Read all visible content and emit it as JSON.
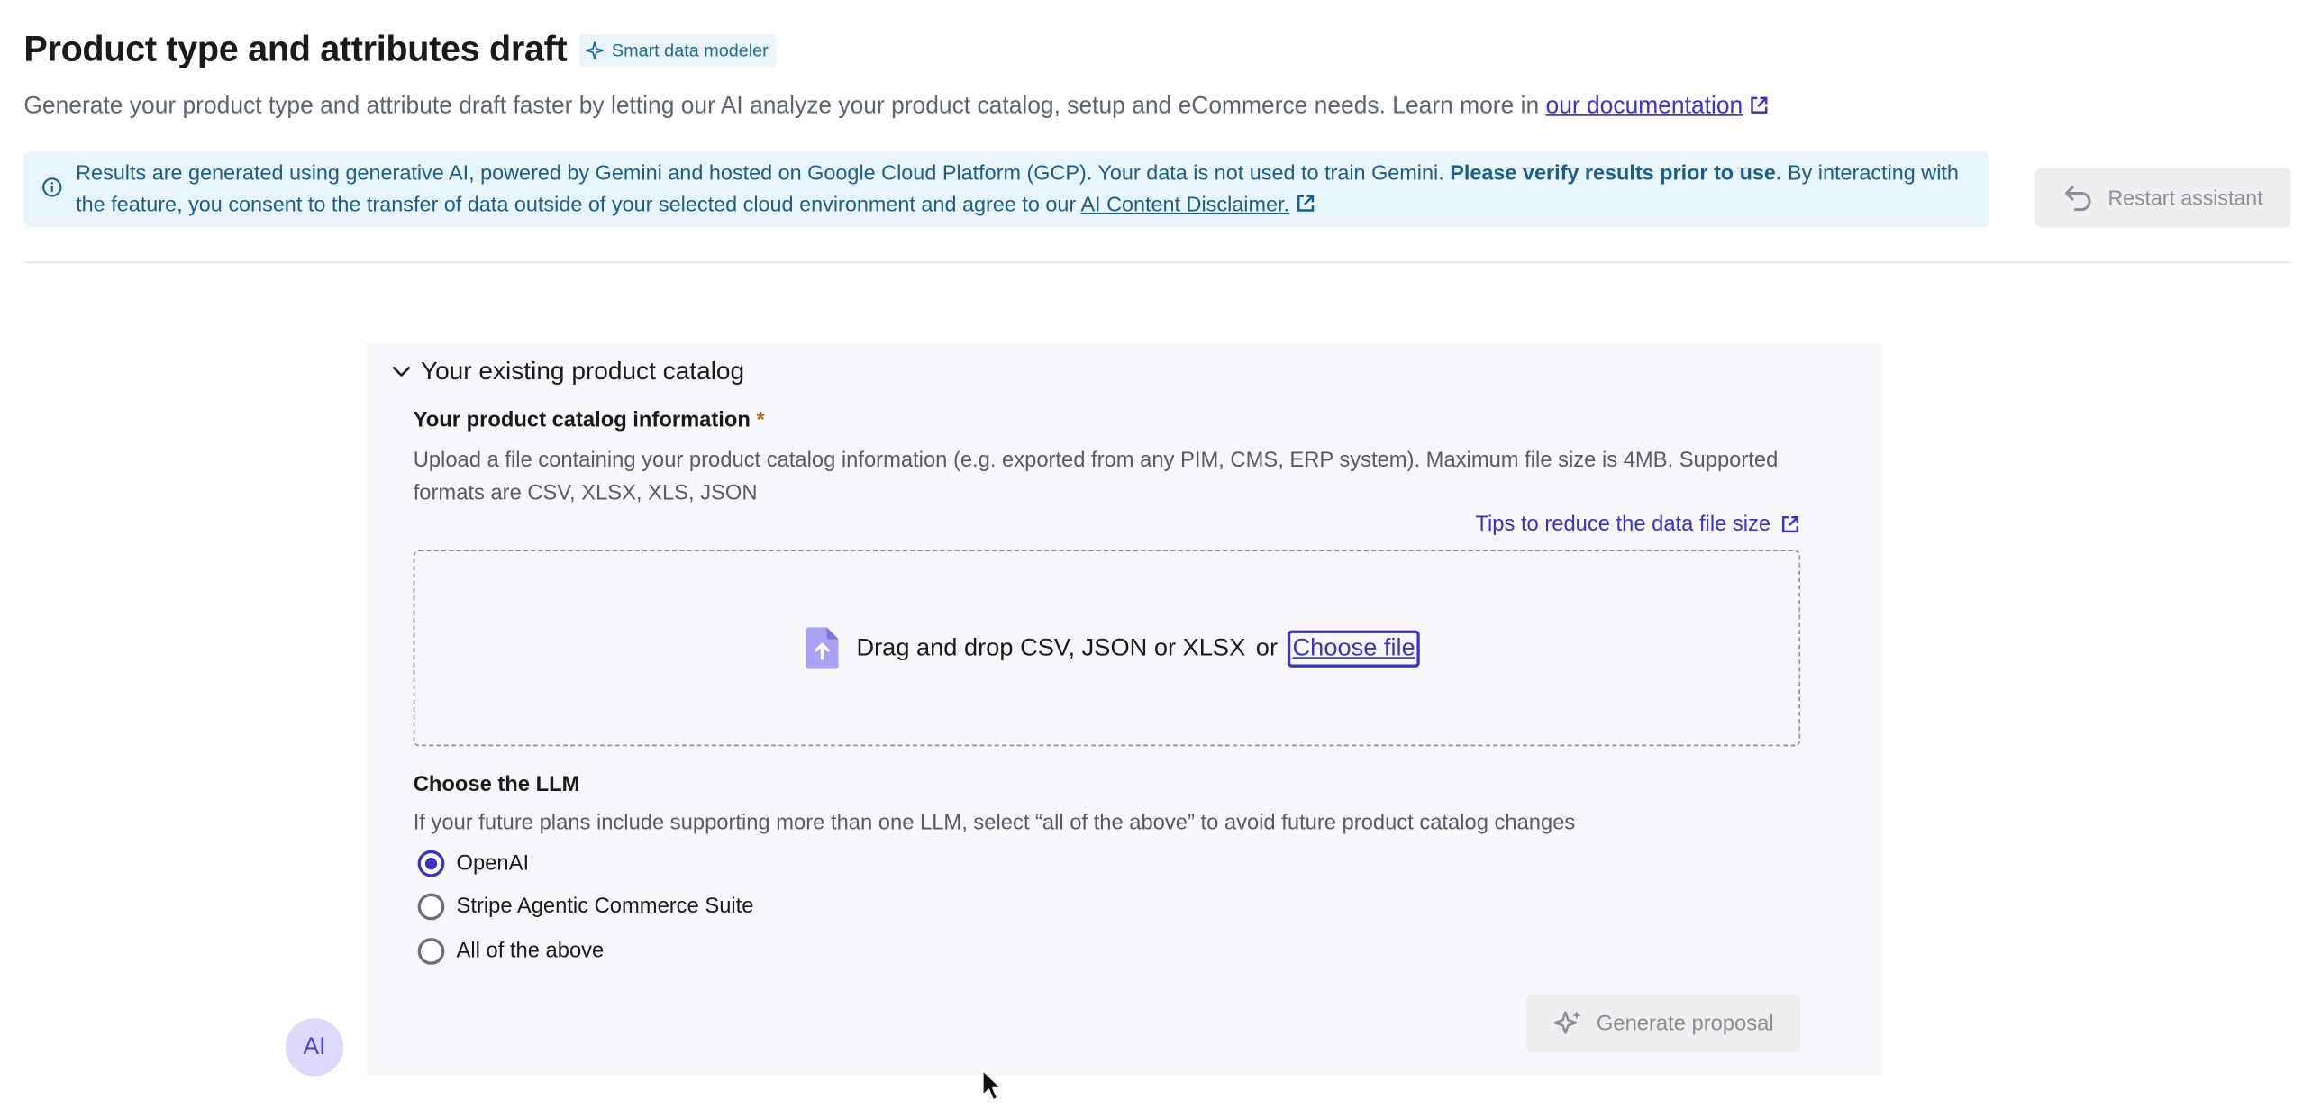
{
  "header": {
    "title": "Product type and attributes draft",
    "badge": "Smart data modeler",
    "subtitle": "Generate your product type and attribute draft faster by letting our AI analyze your product catalog, setup and eCommerce needs. Learn more in",
    "doc_link": "our documentation"
  },
  "banner": {
    "text_1": "Results are generated using generative AI, powered by Gemini and hosted on Google Cloud Platform (GCP). Your data is not used to train Gemini.",
    "bold": "Please verify results prior to use.",
    "text_2": "By interacting with the feature, you consent to the transfer of data outside of your selected cloud environment and agree to our",
    "link": "AI Content Disclaimer."
  },
  "toolbar": {
    "restart_label": "Restart assistant"
  },
  "catalog": {
    "section_title": "Your existing product catalog",
    "field_label": "Your product catalog information",
    "required_mark": "*",
    "help_text": "Upload a file containing your product catalog information (e.g. exported from any PIM, CMS, ERP system). Maximum file size is 4MB. Supported formats are CSV, XLSX, XLS, JSON",
    "tips_link": "Tips to reduce the data file size",
    "dropzone_text": "Drag and drop CSV, JSON or XLSX",
    "dropzone_or": "or",
    "choose_file": "Choose file"
  },
  "llm": {
    "label": "Choose the LLM",
    "help": "If your future plans include supporting more than one LLM, select “all of the above” to avoid future product catalog changes",
    "options": [
      {
        "label": "OpenAI",
        "selected": true
      },
      {
        "label": "Stripe Agentic Commerce Suite",
        "selected": false
      },
      {
        "label": "All of the above",
        "selected": false
      }
    ]
  },
  "actions": {
    "generate_label": "Generate proposal"
  },
  "avatar": {
    "initials": "AI"
  },
  "colors": {
    "accent": "#3a33c4",
    "banner_bg": "#e8f5fc",
    "banner_text": "#1b5e87",
    "required": "#b7651a",
    "disabled_text": "#8a8f99"
  }
}
